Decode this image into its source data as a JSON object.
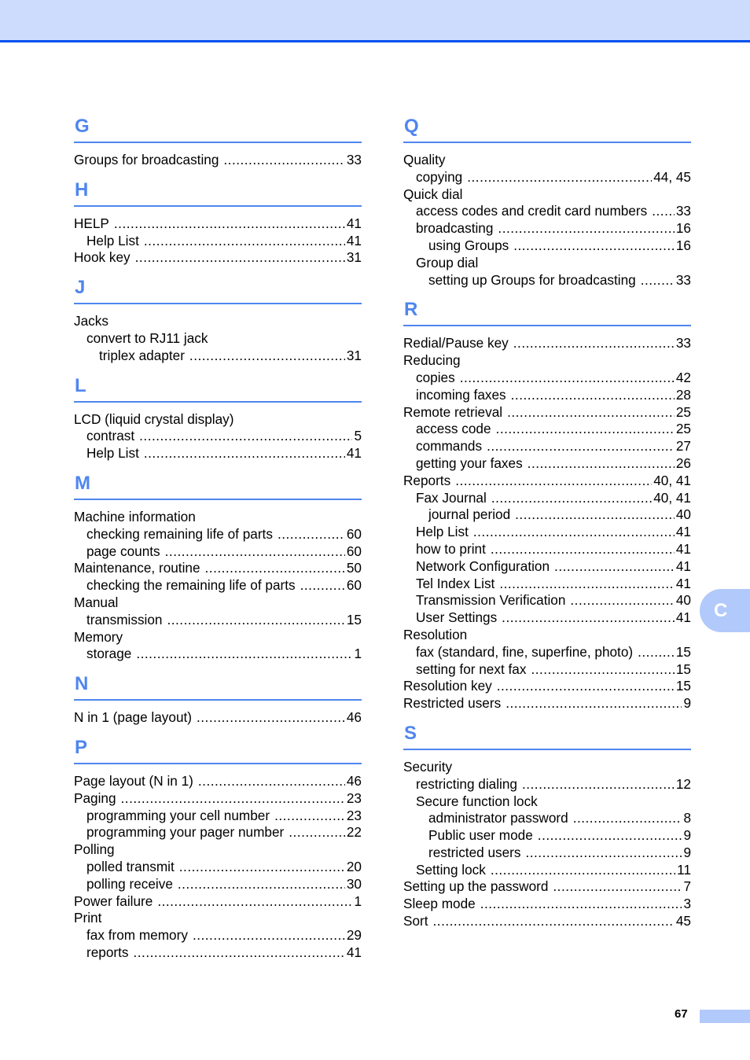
{
  "colors": {
    "accent": "#4f86ee",
    "header_band": "#cddcfd",
    "header_rule": "#0050ee",
    "tab": "#b2c9fb"
  },
  "side_tab": {
    "label": "C"
  },
  "footer": {
    "page_number": "67"
  },
  "left_column": [
    {
      "letter": "G",
      "entries": [
        {
          "level": 0,
          "term": "Groups for broadcasting",
          "page": "33"
        }
      ]
    },
    {
      "letter": "H",
      "entries": [
        {
          "level": 0,
          "term": "HELP",
          "page": "41"
        },
        {
          "level": 1,
          "term": "Help List",
          "page": "41"
        },
        {
          "level": 0,
          "term": "Hook key",
          "page": "31"
        }
      ]
    },
    {
      "letter": "J",
      "entries": [
        {
          "level": 0,
          "term": "Jacks",
          "page": ""
        },
        {
          "level": 1,
          "term": "convert to RJ11 jack",
          "page": ""
        },
        {
          "level": 2,
          "term": "triplex adapter",
          "page": "31"
        }
      ]
    },
    {
      "letter": "L",
      "entries": [
        {
          "level": 0,
          "term": "LCD (liquid crystal display)",
          "page": ""
        },
        {
          "level": 1,
          "term": "contrast",
          "page": "5"
        },
        {
          "level": 1,
          "term": "Help List",
          "page": "41"
        }
      ]
    },
    {
      "letter": "M",
      "entries": [
        {
          "level": 0,
          "term": "Machine information",
          "page": ""
        },
        {
          "level": 1,
          "term": "checking remaining life of parts",
          "page": "60"
        },
        {
          "level": 1,
          "term": "page counts",
          "page": "60"
        },
        {
          "level": 0,
          "term": "Maintenance, routine",
          "page": "50"
        },
        {
          "level": 1,
          "term": "checking the remaining life of parts",
          "page": "60"
        },
        {
          "level": 0,
          "term": "Manual",
          "page": ""
        },
        {
          "level": 1,
          "term": "transmission",
          "page": "15"
        },
        {
          "level": 0,
          "term": "Memory",
          "page": ""
        },
        {
          "level": 1,
          "term": "storage",
          "page": "1"
        }
      ]
    },
    {
      "letter": "N",
      "entries": [
        {
          "level": 0,
          "term": "N in 1 (page layout)",
          "page": "46"
        }
      ]
    },
    {
      "letter": "P",
      "entries": [
        {
          "level": 0,
          "term": "Page layout (N in 1)",
          "page": "46"
        },
        {
          "level": 0,
          "term": "Paging",
          "page": "23"
        },
        {
          "level": 1,
          "term": "programming your cell number",
          "page": "23"
        },
        {
          "level": 1,
          "term": "programming your pager number",
          "page": "22"
        },
        {
          "level": 0,
          "term": "Polling",
          "page": ""
        },
        {
          "level": 1,
          "term": "polled transmit",
          "page": "20"
        },
        {
          "level": 1,
          "term": "polling receive",
          "page": "30"
        },
        {
          "level": 0,
          "term": "Power failure",
          "page": "1"
        },
        {
          "level": 0,
          "term": "Print",
          "page": ""
        },
        {
          "level": 1,
          "term": "fax from memory",
          "page": "29"
        },
        {
          "level": 1,
          "term": "reports",
          "page": "41"
        }
      ]
    }
  ],
  "right_column": [
    {
      "letter": "Q",
      "entries": [
        {
          "level": 0,
          "term": "Quality",
          "page": ""
        },
        {
          "level": 1,
          "term": "copying",
          "page": "44, 45"
        },
        {
          "level": 0,
          "term": "Quick dial",
          "page": ""
        },
        {
          "level": 1,
          "term": "access codes and credit card numbers",
          "page": "33"
        },
        {
          "level": 1,
          "term": "broadcasting",
          "page": "16"
        },
        {
          "level": 2,
          "term": "using Groups",
          "page": "16"
        },
        {
          "level": 1,
          "term": "Group dial",
          "page": ""
        },
        {
          "level": 2,
          "term": "setting up Groups for broadcasting",
          "page": "33"
        }
      ]
    },
    {
      "letter": "R",
      "entries": [
        {
          "level": 0,
          "term": "Redial/Pause key",
          "page": "33"
        },
        {
          "level": 0,
          "term": "Reducing",
          "page": ""
        },
        {
          "level": 1,
          "term": "copies",
          "page": "42"
        },
        {
          "level": 1,
          "term": "incoming faxes",
          "page": "28"
        },
        {
          "level": 0,
          "term": "Remote retrieval",
          "page": "25"
        },
        {
          "level": 1,
          "term": "access code",
          "page": "25"
        },
        {
          "level": 1,
          "term": "commands",
          "page": "27"
        },
        {
          "level": 1,
          "term": "getting your faxes",
          "page": "26"
        },
        {
          "level": 0,
          "term": "Reports",
          "page": "40, 41"
        },
        {
          "level": 1,
          "term": "Fax Journal",
          "page": "40, 41"
        },
        {
          "level": 2,
          "term": "journal period",
          "page": "40"
        },
        {
          "level": 1,
          "term": "Help List",
          "page": "41"
        },
        {
          "level": 1,
          "term": "how to print",
          "page": "41"
        },
        {
          "level": 1,
          "term": "Network Configuration",
          "page": "41"
        },
        {
          "level": 1,
          "term": "Tel Index List",
          "page": "41"
        },
        {
          "level": 1,
          "term": "Transmission Verification",
          "page": "40"
        },
        {
          "level": 1,
          "term": "User Settings",
          "page": "41"
        },
        {
          "level": 0,
          "term": "Resolution",
          "page": ""
        },
        {
          "level": 1,
          "term": "fax (standard, fine, superfine, photo)",
          "page": "15"
        },
        {
          "level": 1,
          "term": "setting for next fax",
          "page": "15"
        },
        {
          "level": 0,
          "term": "Resolution key",
          "page": "15"
        },
        {
          "level": 0,
          "term": "Restricted users",
          "page": "9"
        }
      ]
    },
    {
      "letter": "S",
      "entries": [
        {
          "level": 0,
          "term": "Security",
          "page": ""
        },
        {
          "level": 1,
          "term": "restricting dialing",
          "page": "12"
        },
        {
          "level": 1,
          "term": "Secure function lock",
          "page": ""
        },
        {
          "level": 2,
          "term": "administrator password",
          "page": "8"
        },
        {
          "level": 2,
          "term": "Public user mode",
          "page": "9"
        },
        {
          "level": 2,
          "term": "restricted users",
          "page": "9"
        },
        {
          "level": 1,
          "term": "Setting lock",
          "page": "11"
        },
        {
          "level": 0,
          "term": "Setting up the password",
          "page": "7"
        },
        {
          "level": 0,
          "term": "Sleep mode",
          "page": "3"
        },
        {
          "level": 0,
          "term": "Sort",
          "page": "45"
        }
      ]
    }
  ]
}
